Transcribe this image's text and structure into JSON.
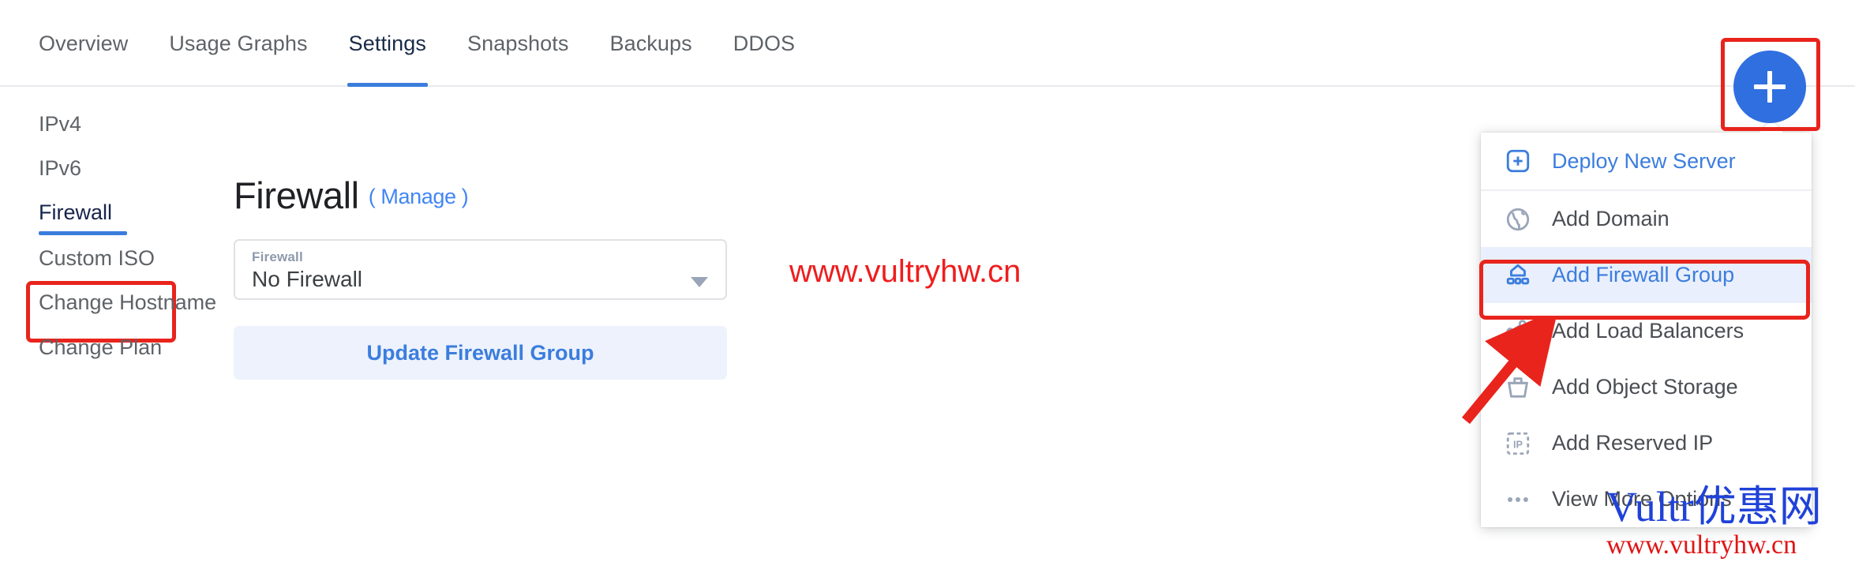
{
  "tabs": [
    {
      "label": "Overview",
      "active": false
    },
    {
      "label": "Usage Graphs",
      "active": false
    },
    {
      "label": "Settings",
      "active": true
    },
    {
      "label": "Snapshots",
      "active": false
    },
    {
      "label": "Backups",
      "active": false
    },
    {
      "label": "DDOS",
      "active": false
    }
  ],
  "add_button": {
    "icon": "plus-icon",
    "label": "+"
  },
  "sidebar": {
    "items": [
      {
        "label": "IPv4",
        "active": false
      },
      {
        "label": "IPv6",
        "active": false
      },
      {
        "label": "Firewall",
        "active": true
      },
      {
        "label": "Custom ISO",
        "active": false
      },
      {
        "label": "Change Hostname",
        "active": false
      },
      {
        "label": "Change Plan",
        "active": false
      }
    ]
  },
  "main": {
    "title": "Firewall",
    "manage_link": "( Manage )",
    "firewall_select": {
      "label": "Firewall",
      "value": "No Firewall",
      "arrow_icon": "chevron-down-icon"
    },
    "update_button": "Update Firewall Group"
  },
  "dropdown_menu": {
    "items": [
      {
        "label": "Deploy New Server",
        "icon": "plus-square-icon",
        "style": "blue",
        "selected": false
      },
      {
        "label": "Add Domain",
        "icon": "globe-icon",
        "style": "gray",
        "selected": false
      },
      {
        "label": "Add Firewall Group",
        "icon": "firewall-icon",
        "style": "blue",
        "selected": true
      },
      {
        "label": "Add Load Balancers",
        "icon": "load-balancer-icon",
        "style": "gray",
        "selected": false
      },
      {
        "label": "Add Object Storage",
        "icon": "bucket-icon",
        "style": "gray",
        "selected": false
      },
      {
        "label": "Add Reserved IP",
        "icon": "reserved-ip-icon",
        "style": "gray",
        "selected": false
      },
      {
        "label": "View More Options",
        "icon": "ellipsis-icon",
        "style": "gray",
        "selected": false
      }
    ]
  },
  "watermarks": {
    "select_overlay": "www.vultryhw.cn",
    "bottom_main": "Vultr优惠网",
    "bottom_sub": "www.vultryhw.cn"
  },
  "colors": {
    "accent_blue": "#3b7ddd",
    "plus_blue": "#2f6fe0",
    "highlight_red": "#e8241c",
    "menu_selected_bg": "#e9effc",
    "watermark_red": "#ef1d1d",
    "watermark_blue": "#1f42d8"
  }
}
